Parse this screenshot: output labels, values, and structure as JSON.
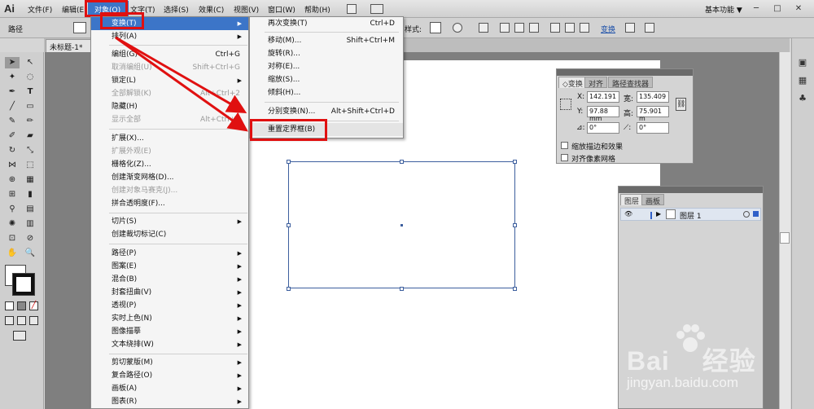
{
  "app": {
    "logo": "Ai",
    "workspace": "基本功能",
    "workspace_arrow": "▼"
  },
  "menubar": {
    "items": [
      "文件(F)",
      "编辑(E)",
      "对象(O)",
      "文字(T)",
      "选择(S)",
      "效果(C)",
      "视图(V)",
      "窗口(W)",
      "帮助(H)"
    ]
  },
  "window_controls": {
    "min": "─",
    "max": "□",
    "close": "✕"
  },
  "controlbar": {
    "path_label": "路径",
    "style_label": "样式:",
    "transform_link": "变换"
  },
  "document": {
    "tab_title": "未标题-1* @"
  },
  "object_menu": {
    "rows": [
      {
        "label": "变换(T)",
        "shortcut": "",
        "arrow": "▶"
      },
      {
        "label": "排列(A)",
        "shortcut": "",
        "arrow": "▶"
      },
      {
        "label": "编组(G)",
        "shortcut": "Ctrl+G",
        "arrow": ""
      },
      {
        "label": "取消编组(U)",
        "shortcut": "Shift+Ctrl+G",
        "arrow": ""
      },
      {
        "label": "锁定(L)",
        "shortcut": "",
        "arrow": "▶"
      },
      {
        "label": "全部解锁(K)",
        "shortcut": "Alt+Ctrl+2",
        "arrow": ""
      },
      {
        "label": "隐藏(H)",
        "shortcut": "",
        "arrow": ""
      },
      {
        "label": "显示全部",
        "shortcut": "Alt+Ctrl+3",
        "arrow": ""
      },
      {
        "label": "扩展(X)...",
        "shortcut": "",
        "arrow": ""
      },
      {
        "label": "扩展外观(E)",
        "shortcut": "",
        "arrow": ""
      },
      {
        "label": "栅格化(Z)...",
        "shortcut": "",
        "arrow": ""
      },
      {
        "label": "创建渐变网格(D)...",
        "shortcut": "",
        "arrow": ""
      },
      {
        "label": "创建对象马赛克(J)...",
        "shortcut": "",
        "arrow": ""
      },
      {
        "label": "拼合透明度(F)...",
        "shortcut": "",
        "arrow": ""
      },
      {
        "label": "切片(S)",
        "shortcut": "",
        "arrow": "▶"
      },
      {
        "label": "创建裁切标记(C)",
        "shortcut": "",
        "arrow": ""
      },
      {
        "label": "路径(P)",
        "shortcut": "",
        "arrow": "▶"
      },
      {
        "label": "图案(E)",
        "shortcut": "",
        "arrow": "▶"
      },
      {
        "label": "混合(B)",
        "shortcut": "",
        "arrow": "▶"
      },
      {
        "label": "封套扭曲(V)",
        "shortcut": "",
        "arrow": "▶"
      },
      {
        "label": "透视(P)",
        "shortcut": "",
        "arrow": "▶"
      },
      {
        "label": "实时上色(N)",
        "shortcut": "",
        "arrow": "▶"
      },
      {
        "label": "图像描摹",
        "shortcut": "",
        "arrow": "▶"
      },
      {
        "label": "文本绕排(W)",
        "shortcut": "",
        "arrow": "▶"
      },
      {
        "label": "剪切蒙版(M)",
        "shortcut": "",
        "arrow": "▶"
      },
      {
        "label": "复合路径(O)",
        "shortcut": "",
        "arrow": "▶"
      },
      {
        "label": "画板(A)",
        "shortcut": "",
        "arrow": "▶"
      },
      {
        "label": "图表(R)",
        "shortcut": "",
        "arrow": "▶"
      }
    ]
  },
  "transform_submenu": {
    "rows": [
      {
        "label": "再次变换(T)",
        "shortcut": "Ctrl+D"
      },
      {
        "label": "移动(M)...",
        "shortcut": "Shift+Ctrl+M"
      },
      {
        "label": "旋转(R)...",
        "shortcut": ""
      },
      {
        "label": "对称(E)...",
        "shortcut": ""
      },
      {
        "label": "缩放(S)...",
        "shortcut": ""
      },
      {
        "label": "倾斜(H)...",
        "shortcut": ""
      },
      {
        "label": "分别变换(N)...",
        "shortcut": "Alt+Shift+Ctrl+D"
      },
      {
        "label": "重置定界框(B)",
        "shortcut": ""
      }
    ]
  },
  "transform_panel": {
    "tabs": [
      "◇变换",
      "对齐",
      "路径查找器"
    ],
    "x_label": "X:",
    "x_value": "142.191",
    "w_label": "宽:",
    "w_value": "135.409",
    "y_label": "Y:",
    "y_value": "97.88 mm",
    "h_label": "高:",
    "h_value": "75.901 m",
    "angle_value": "0°",
    "shear_value": "0°",
    "scale_strokes": "缩放描边和效果",
    "align_pixel": "对齐像素网格"
  },
  "layers_panel": {
    "tabs": [
      "图层",
      "画板"
    ],
    "layer_name": "图层 1"
  },
  "watermark": {
    "brand": "Bai",
    "brand2": "经验",
    "url": "jingyan.baidu.com"
  },
  "colors": {
    "accent": "#3c75c8",
    "highlight_red": "#e01010",
    "selection": "#3d5f9e"
  }
}
